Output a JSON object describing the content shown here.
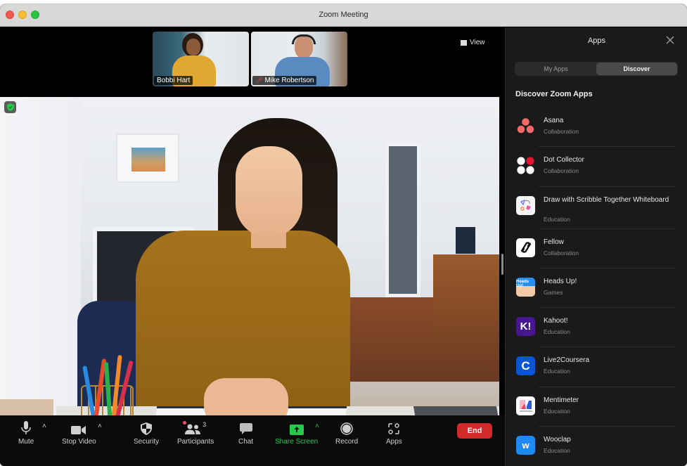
{
  "window": {
    "title": "Zoom Meeting"
  },
  "meeting": {
    "view_label": "View",
    "thumbnails": [
      {
        "name": "Bobbi Hart",
        "muted": false
      },
      {
        "name": "Mike Robertson",
        "muted": true
      }
    ]
  },
  "toolbar": {
    "mute": "Mute",
    "stop_video": "Stop Video",
    "security": "Security",
    "participants": "Participants",
    "participants_count": "3",
    "chat": "Chat",
    "share_screen": "Share Screen",
    "record": "Record",
    "apps": "Apps",
    "end": "End"
  },
  "colors": {
    "share_accent": "#27c94d",
    "end_button": "#d12a2a",
    "panel_bg": "#1a1a1b"
  },
  "apps_panel": {
    "title": "Apps",
    "tabs": [
      {
        "label": "My Apps",
        "active": false
      },
      {
        "label": "Discover",
        "active": true
      }
    ],
    "heading": "Discover Zoom Apps",
    "apps": [
      {
        "name": "Asana",
        "category": "Collaboration",
        "icon": "asana-icon"
      },
      {
        "name": "Dot Collector",
        "category": "Collaboration",
        "icon": "dot-collector-icon"
      },
      {
        "name": "Draw with Scribble Together Whiteboard",
        "category": "Education",
        "icon": "scribble-icon"
      },
      {
        "name": "Fellow",
        "category": "Collaboration",
        "icon": "fellow-icon"
      },
      {
        "name": "Heads Up!",
        "category": "Games",
        "icon": "heads-up-icon"
      },
      {
        "name": "Kahoot!",
        "category": "Education",
        "icon": "kahoot-icon"
      },
      {
        "name": "Live2Coursera",
        "category": "Education",
        "icon": "coursera-icon"
      },
      {
        "name": "Mentimeter",
        "category": "Education",
        "icon": "mentimeter-icon"
      },
      {
        "name": "Wooclap",
        "category": "Education",
        "icon": "wooclap-icon"
      }
    ],
    "icon_text": {
      "heads_up": "Heads Up!",
      "kahoot": "K!",
      "coursera": "C",
      "wooclap": "w"
    }
  }
}
